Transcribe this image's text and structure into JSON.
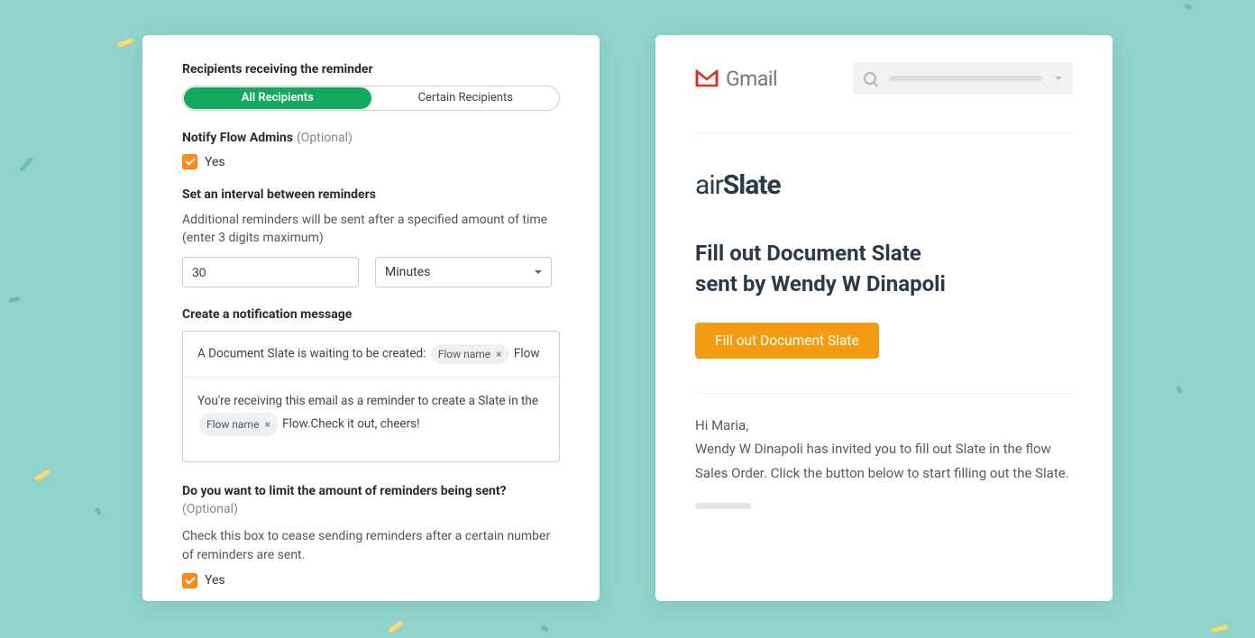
{
  "left": {
    "recipients": {
      "title": "Recipients receiving the reminder",
      "options": [
        "All Recipients",
        "Certain Recipients"
      ],
      "active_index": 0
    },
    "notify_admins": {
      "title": "Notify Flow Admins",
      "optional": "(Optional)",
      "checkbox_label": "Yes",
      "checked": true
    },
    "interval": {
      "title": "Set an interval between reminders",
      "desc": "Additional reminders will be sent after a specified amount of time (enter 3 digits maximum)",
      "value": "30",
      "unit": "Minutes"
    },
    "message": {
      "title": "Create a notification message",
      "subject_prefix": "A Document Slate is waiting to be created:",
      "chip_label": "Flow name",
      "subject_suffix": "Flow",
      "body_line1": "You're receiving this email as a reminder to create a Slate in the",
      "body_after_chip": "Flow.Check it out, cheers!"
    },
    "limit": {
      "title": "Do you want to limit the amount of reminders being sent?",
      "optional": "(Optional)",
      "desc": "Check this box to cease sending reminders after a certain number of reminders are sent.",
      "checkbox_label": "Yes",
      "checked": true
    }
  },
  "right": {
    "gmail_label": "Gmail",
    "airslate_brand_air": "air",
    "airslate_brand_slate": "Slate",
    "heading_line1": "Fill out Document Slate",
    "heading_line2": "sent by Wendy W Dinapoli",
    "cta": "Fill out Document Slate",
    "greeting": "Hi Maria,",
    "body": "Wendy W Dinapoli has invited you to fill out Slate in the flow Sales Order. Click the button below to start filling out the Slate."
  }
}
